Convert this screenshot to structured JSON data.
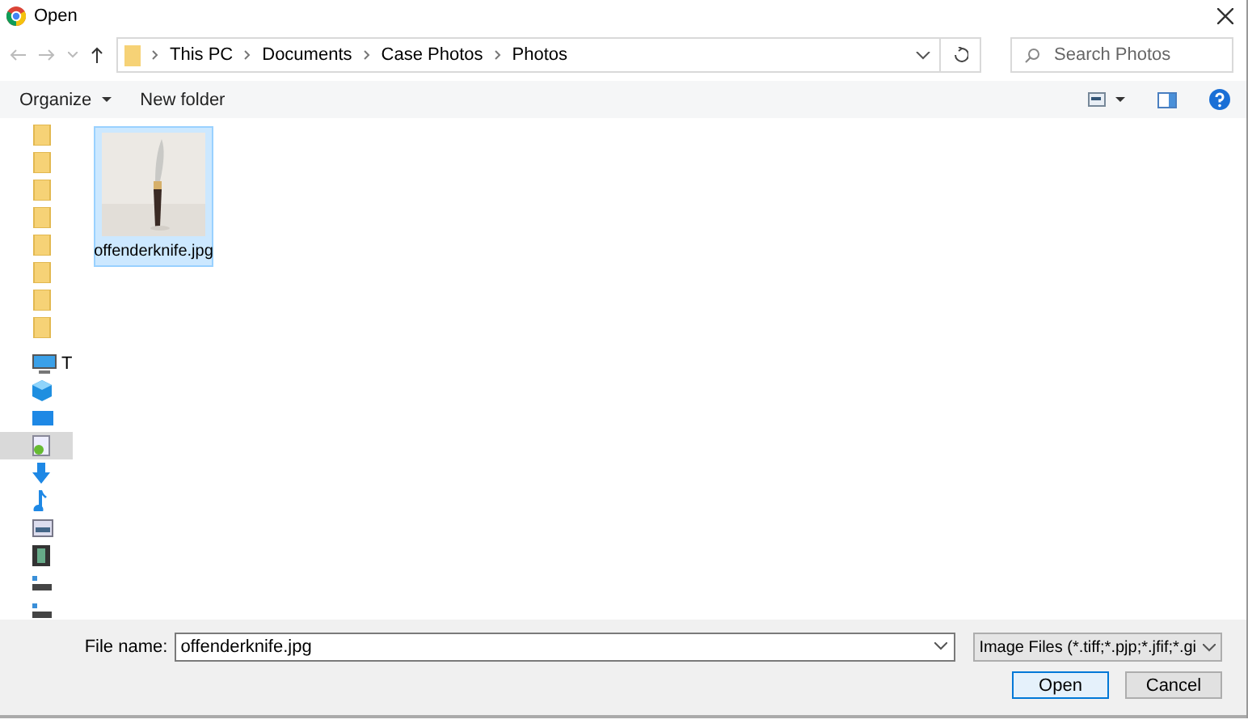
{
  "window": {
    "title": "Open"
  },
  "address": {
    "crumbs": [
      "This PC",
      "Documents",
      "Case Photos",
      "Photos"
    ]
  },
  "search": {
    "placeholder": "Search Photos"
  },
  "toolbar": {
    "organize": "Organize",
    "new_folder": "New folder"
  },
  "nav": {
    "items": [
      {
        "kind": "folder",
        "selected": false
      },
      {
        "kind": "folder",
        "selected": false
      },
      {
        "kind": "folder",
        "selected": false
      },
      {
        "kind": "folder",
        "selected": false
      },
      {
        "kind": "folder",
        "selected": false
      },
      {
        "kind": "folder",
        "selected": false
      },
      {
        "kind": "folder",
        "selected": false
      },
      {
        "kind": "folder",
        "selected": false
      },
      {
        "kind": "pc",
        "label": "T",
        "selected": false
      },
      {
        "kind": "cube",
        "selected": false
      },
      {
        "kind": "desktop",
        "selected": false
      },
      {
        "kind": "documents",
        "selected": true
      },
      {
        "kind": "download",
        "selected": false
      },
      {
        "kind": "music",
        "selected": false
      },
      {
        "kind": "pictures",
        "selected": false
      },
      {
        "kind": "videos",
        "selected": false
      },
      {
        "kind": "drive",
        "selected": false
      },
      {
        "kind": "drive",
        "selected": false
      }
    ]
  },
  "files": [
    {
      "name": "offenderknife.jpg",
      "selected": true,
      "kind": "picture"
    }
  ],
  "file_name": {
    "label": "File name:",
    "value": "offenderknife.jpg"
  },
  "file_type": {
    "value": "Image Files (*.tiff;*.pjp;*.jfif;*.gi"
  },
  "buttons": [
    {
      "label": "Open",
      "kind": "primary"
    },
    {
      "label": "Cancel",
      "kind": "normal"
    }
  ]
}
